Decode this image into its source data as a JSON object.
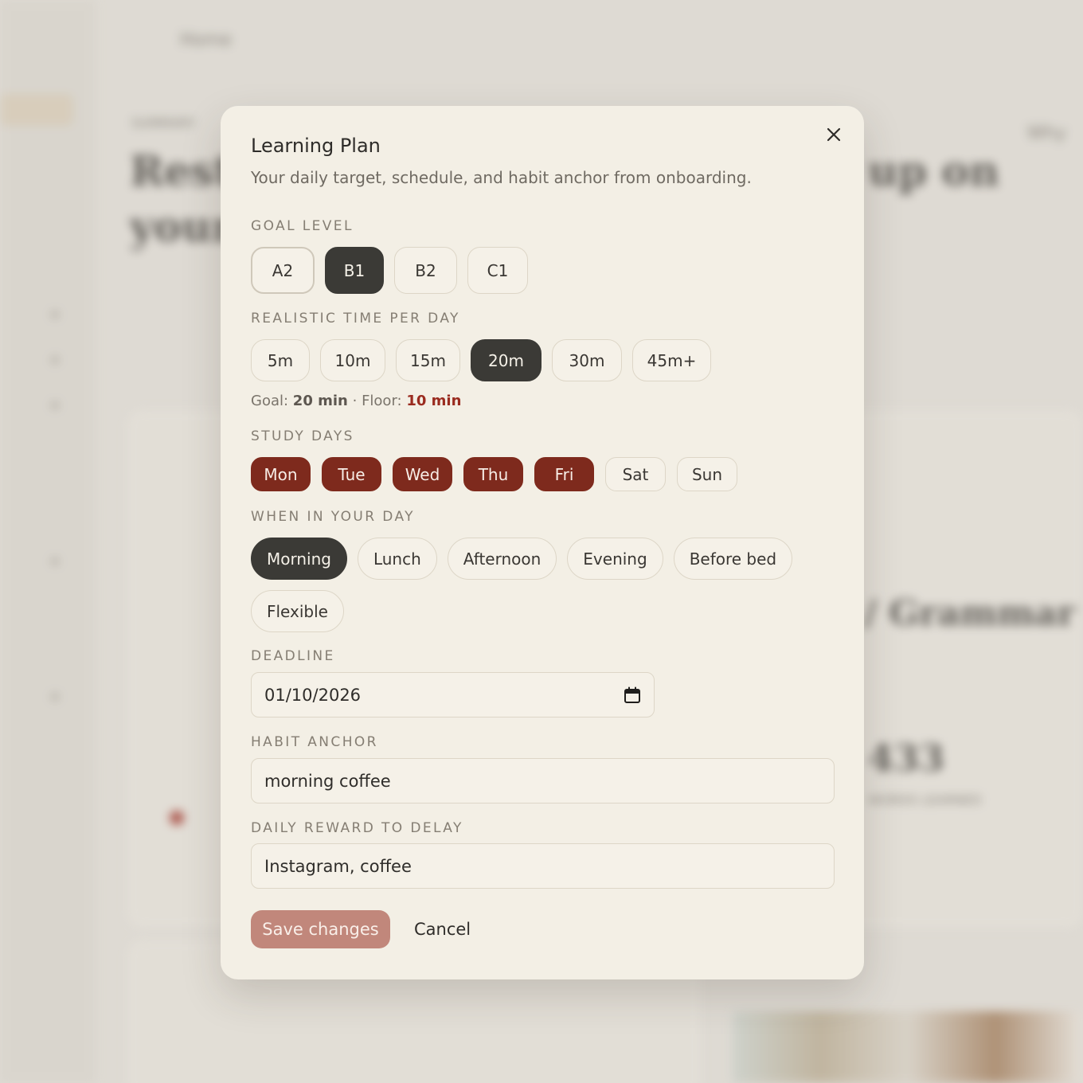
{
  "background": {
    "breadcrumb": "Home",
    "summary_label": "SUMMARY",
    "heading_line1": "Rest",
    "heading_line2": "your",
    "heading_right": "up on",
    "grammar": "/ Grammar",
    "stat_value": "433",
    "stat_label": "WORDS LEARNED",
    "side_btn": "Why"
  },
  "modal": {
    "title": "Learning Plan",
    "subtitle": "Your daily target, schedule, and habit anchor from onboarding.",
    "goal_level": {
      "label": "GOAL LEVEL",
      "options": [
        "A2",
        "B1",
        "B2",
        "C1"
      ],
      "selected": "B1"
    },
    "time_per_day": {
      "label": "REALISTIC TIME PER DAY",
      "options": [
        "5m",
        "10m",
        "15m",
        "20m",
        "30m",
        "45m+"
      ],
      "selected": "20m",
      "goal_prefix": "Goal:",
      "goal_value": "20 min",
      "sep": "·",
      "floor_prefix": "Floor:",
      "floor_value": "10 min"
    },
    "study_days": {
      "label": "STUDY DAYS",
      "options": [
        "Mon",
        "Tue",
        "Wed",
        "Thu",
        "Fri",
        "Sat",
        "Sun"
      ],
      "selected": [
        "Mon",
        "Tue",
        "Wed",
        "Thu",
        "Fri"
      ]
    },
    "when": {
      "label": "WHEN IN YOUR DAY",
      "options": [
        "Morning",
        "Lunch",
        "Afternoon",
        "Evening",
        "Before bed",
        "Flexible"
      ],
      "selected": "Morning"
    },
    "deadline": {
      "label": "DEADLINE",
      "value": "01/10/2026"
    },
    "habit_anchor": {
      "label": "HABIT ANCHOR",
      "value": "morning coffee"
    },
    "reward": {
      "label": "DAILY REWARD TO DELAY",
      "value": "Instagram, coffee"
    },
    "save_label": "Save changes",
    "cancel_label": "Cancel"
  },
  "colors": {
    "accent_red": "#7e2a1d",
    "dark_chip": "#3b3a36",
    "save_button": "#c1877b",
    "modal_bg": "#f3efe5"
  }
}
